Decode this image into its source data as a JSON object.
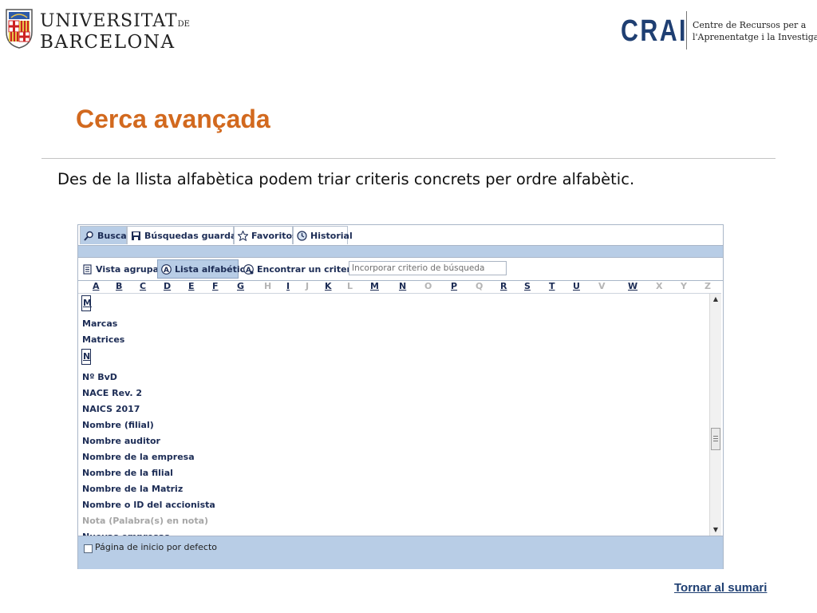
{
  "header": {
    "ub_logo": {
      "line1": "UNIVERSITAT",
      "line1_suffix": "DE",
      "line2": "BARCELONA"
    },
    "crai_logo": {
      "mark": "CRAI",
      "text_line1": "Centre de Recursos per a",
      "text_line2": "l'Aprenentatge i la Investigació"
    }
  },
  "slide": {
    "title": "Cerca avançada",
    "description": "Des de la llista alfabètica podem triar criteris concrets per ordre alfabètic."
  },
  "app": {
    "tabs": [
      {
        "label": "Buscar",
        "icon": "search-icon",
        "active": true
      },
      {
        "label": "Búsquedas guardadas",
        "icon": "save-icon",
        "active": false
      },
      {
        "label": "Favoritos",
        "icon": "star-icon",
        "active": false
      },
      {
        "label": "Historial",
        "icon": "history-icon",
        "active": false
      }
    ],
    "toolbar": {
      "grouped_view": "Vista agrupada",
      "alphabetical_list": "Lista alfabética",
      "find_criterion": "Encontrar un criterio",
      "criterion_placeholder": "Incorporar criterio de búsqueda"
    },
    "letters": [
      {
        "l": "A",
        "on": true
      },
      {
        "l": "B",
        "on": true
      },
      {
        "l": "C",
        "on": true
      },
      {
        "l": "D",
        "on": true
      },
      {
        "l": "E",
        "on": true
      },
      {
        "l": "F",
        "on": true
      },
      {
        "l": "G",
        "on": true
      },
      {
        "l": "H",
        "on": false
      },
      {
        "l": "I",
        "on": true
      },
      {
        "l": "J",
        "on": false
      },
      {
        "l": "K",
        "on": true
      },
      {
        "l": "L",
        "on": false
      },
      {
        "l": "M",
        "on": true
      },
      {
        "l": "N",
        "on": true
      },
      {
        "l": "O",
        "on": false
      },
      {
        "l": "P",
        "on": true
      },
      {
        "l": "Q",
        "on": false
      },
      {
        "l": "R",
        "on": true
      },
      {
        "l": "S",
        "on": true
      },
      {
        "l": "T",
        "on": true
      },
      {
        "l": "U",
        "on": true
      },
      {
        "l": "V",
        "on": false
      },
      {
        "l": "W",
        "on": true
      },
      {
        "l": "X",
        "on": false
      },
      {
        "l": "Y",
        "on": false
      },
      {
        "l": "Z",
        "on": false
      }
    ],
    "list": [
      {
        "type": "group",
        "text": "M"
      },
      {
        "type": "item",
        "text": "Marcas",
        "on": true
      },
      {
        "type": "item",
        "text": "Matrices",
        "on": true
      },
      {
        "type": "group",
        "text": "N"
      },
      {
        "type": "item",
        "text": "Nº BvD",
        "on": true
      },
      {
        "type": "item",
        "text": "NACE Rev. 2",
        "on": true
      },
      {
        "type": "item",
        "text": "NAICS 2017",
        "on": true
      },
      {
        "type": "item",
        "text": "Nombre (filial)",
        "on": true
      },
      {
        "type": "item",
        "text": "Nombre auditor",
        "on": true
      },
      {
        "type": "item",
        "text": "Nombre de la empresa",
        "on": true
      },
      {
        "type": "item",
        "text": "Nombre de la filial",
        "on": true
      },
      {
        "type": "item",
        "text": "Nombre de la Matriz",
        "on": true
      },
      {
        "type": "item",
        "text": "Nombre o ID del accionista",
        "on": true
      },
      {
        "type": "item",
        "text": "Nota (Palabra(s) en nota)",
        "on": false
      },
      {
        "type": "item",
        "text": "Nuevas empresas",
        "on": true
      }
    ],
    "footer": {
      "default_start_label": "Página de inicio por defecto",
      "default_start_checked": false
    }
  },
  "links": {
    "return": "Tornar al sumari"
  },
  "colors": {
    "title": "#d2691e",
    "navy": "#1c2c55",
    "panel_blue": "#b8cde6",
    "crai_blue": "#1f3f72"
  }
}
